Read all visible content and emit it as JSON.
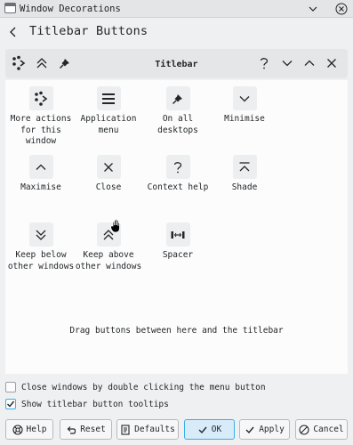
{
  "window": {
    "title": "Window Decorations"
  },
  "header": {
    "title": "Titlebar Buttons"
  },
  "preview": {
    "title": "Titlebar"
  },
  "palette": {
    "items": [
      {
        "label": "More actions for this window",
        "icon": "more-actions-icon"
      },
      {
        "label": "Application menu",
        "icon": "hamburger-menu-icon"
      },
      {
        "label": "On all desktops",
        "icon": "pin-icon"
      },
      {
        "label": "Minimise",
        "icon": "chevron-down-icon"
      },
      {
        "label": "Maximise",
        "icon": "chevron-up-icon"
      },
      {
        "label": "Close",
        "icon": "close-icon"
      },
      {
        "label": "Context help",
        "icon": "question-icon"
      },
      {
        "label": "Shade",
        "icon": "shade-icon"
      },
      {
        "label": "Keep below other windows",
        "icon": "double-chevron-down-icon"
      },
      {
        "label": "Keep above other windows",
        "icon": "double-chevron-up-icon"
      },
      {
        "label": "Spacer",
        "icon": "spacer-icon"
      }
    ],
    "hint": "Drag buttons between here and the titlebar"
  },
  "options": {
    "close_double_click": {
      "label": "Close windows by double clicking the menu button",
      "checked": false
    },
    "show_tooltips": {
      "label": "Show titlebar button tooltips",
      "checked": true
    }
  },
  "footer": {
    "help": "Help",
    "reset": "Reset",
    "defaults": "Defaults",
    "ok": "OK",
    "apply": "Apply",
    "cancel": "Cancel"
  },
  "colors": {
    "accent": "#3daee9",
    "background": "#eff0f1",
    "panel": "#fcfcfc"
  }
}
